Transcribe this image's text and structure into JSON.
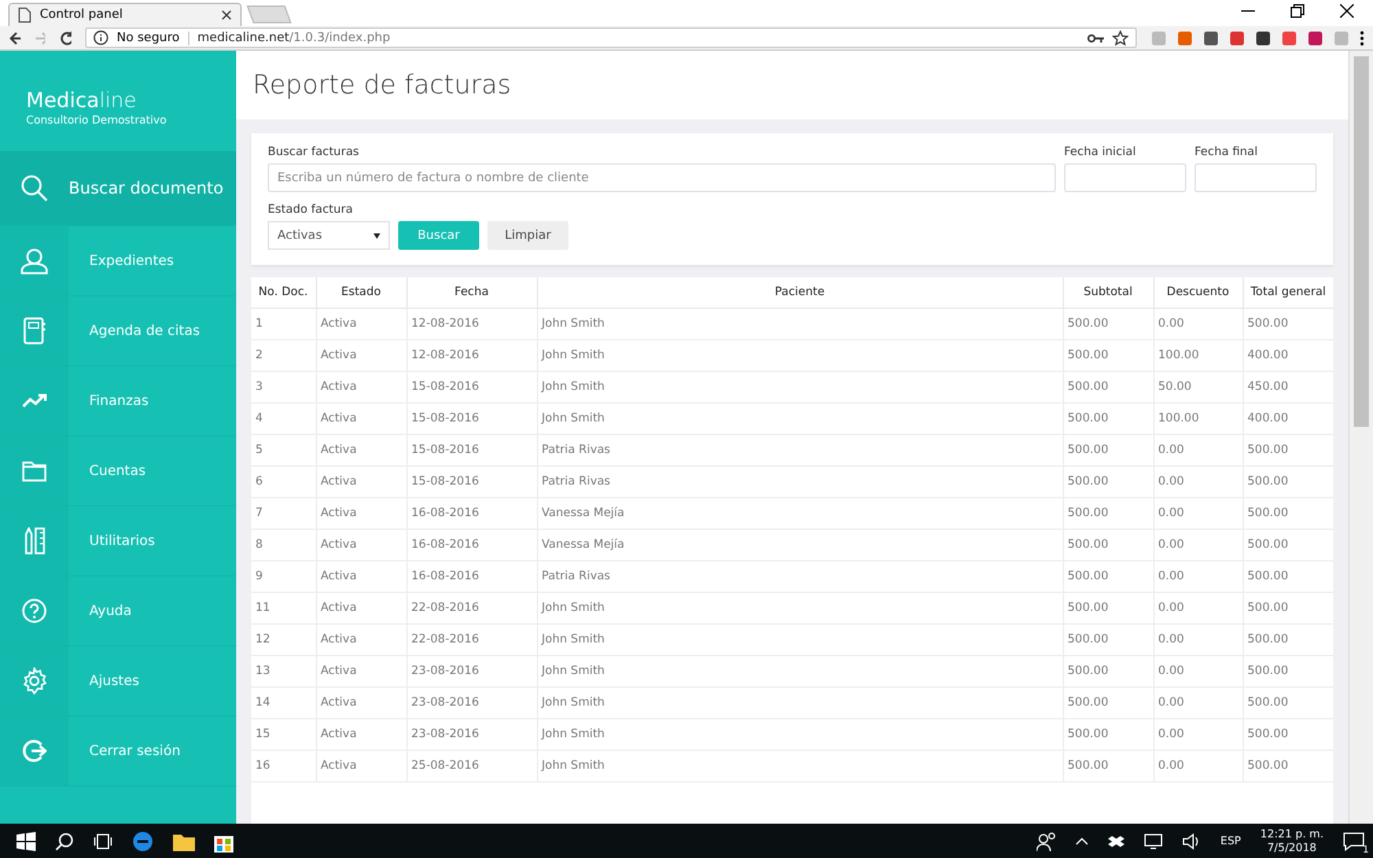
{
  "browser": {
    "tab_title": "Control panel",
    "security": "No seguro",
    "url_host": "medicaline.net",
    "url_path": "/1.0.3/index.php"
  },
  "sidebar": {
    "brand": "Medica",
    "brand_rest": "line",
    "subtitle": "Consultorio Demostrativo",
    "items": [
      {
        "label": "Buscar documento",
        "selected": true
      },
      {
        "label": "Expedientes",
        "selected": false
      },
      {
        "label": "Agenda de citas",
        "selected": false
      },
      {
        "label": "Finanzas",
        "selected": false
      },
      {
        "label": "Cuentas",
        "selected": false
      },
      {
        "label": "Utilitarios",
        "selected": false
      },
      {
        "label": "Ayuda",
        "selected": false
      },
      {
        "label": "Ajustes",
        "selected": false
      },
      {
        "label": "Cerrar sesión",
        "selected": false
      }
    ]
  },
  "page_title": "Reporte de facturas",
  "filters": {
    "search_label": "Buscar facturas",
    "search_placeholder": "Escriba un número de factura o nombre de cliente",
    "start_label": "Fecha inicial",
    "end_label": "Fecha final",
    "status_label": "Estado factura",
    "status_value": "Activas",
    "search_button": "Buscar",
    "clear_button": "Limpiar"
  },
  "table": {
    "columns": [
      "No. Doc.",
      "Estado",
      "Fecha",
      "Paciente",
      "Subtotal",
      "Descuento",
      "Total general"
    ],
    "rows": [
      [
        "1",
        "Activa",
        "12-08-2016",
        "John Smith",
        "500.00",
        "0.00",
        "500.00"
      ],
      [
        "2",
        "Activa",
        "12-08-2016",
        "John Smith",
        "500.00",
        "100.00",
        "400.00"
      ],
      [
        "3",
        "Activa",
        "15-08-2016",
        "John Smith",
        "500.00",
        "50.00",
        "450.00"
      ],
      [
        "4",
        "Activa",
        "15-08-2016",
        "John Smith",
        "500.00",
        "100.00",
        "400.00"
      ],
      [
        "5",
        "Activa",
        "15-08-2016",
        "Patria Rivas",
        "500.00",
        "0.00",
        "500.00"
      ],
      [
        "6",
        "Activa",
        "15-08-2016",
        "Patria Rivas",
        "500.00",
        "0.00",
        "500.00"
      ],
      [
        "7",
        "Activa",
        "16-08-2016",
        "Vanessa Mejía",
        "500.00",
        "0.00",
        "500.00"
      ],
      [
        "8",
        "Activa",
        "16-08-2016",
        "Vanessa Mejía",
        "500.00",
        "0.00",
        "500.00"
      ],
      [
        "9",
        "Activa",
        "16-08-2016",
        "Patria Rivas",
        "500.00",
        "0.00",
        "500.00"
      ],
      [
        "11",
        "Activa",
        "22-08-2016",
        "John Smith",
        "500.00",
        "0.00",
        "500.00"
      ],
      [
        "12",
        "Activa",
        "22-08-2016",
        "John Smith",
        "500.00",
        "0.00",
        "500.00"
      ],
      [
        "13",
        "Activa",
        "23-08-2016",
        "John Smith",
        "500.00",
        "0.00",
        "500.00"
      ],
      [
        "14",
        "Activa",
        "23-08-2016",
        "John Smith",
        "500.00",
        "0.00",
        "500.00"
      ],
      [
        "15",
        "Activa",
        "23-08-2016",
        "John Smith",
        "500.00",
        "0.00",
        "500.00"
      ],
      [
        "16",
        "Activa",
        "25-08-2016",
        "John Smith",
        "500.00",
        "0.00",
        "500.00"
      ]
    ]
  },
  "taskbar": {
    "language": "ESP",
    "time": "12:21 p. m.",
    "date": "7/5/2018",
    "notifications": "1"
  }
}
